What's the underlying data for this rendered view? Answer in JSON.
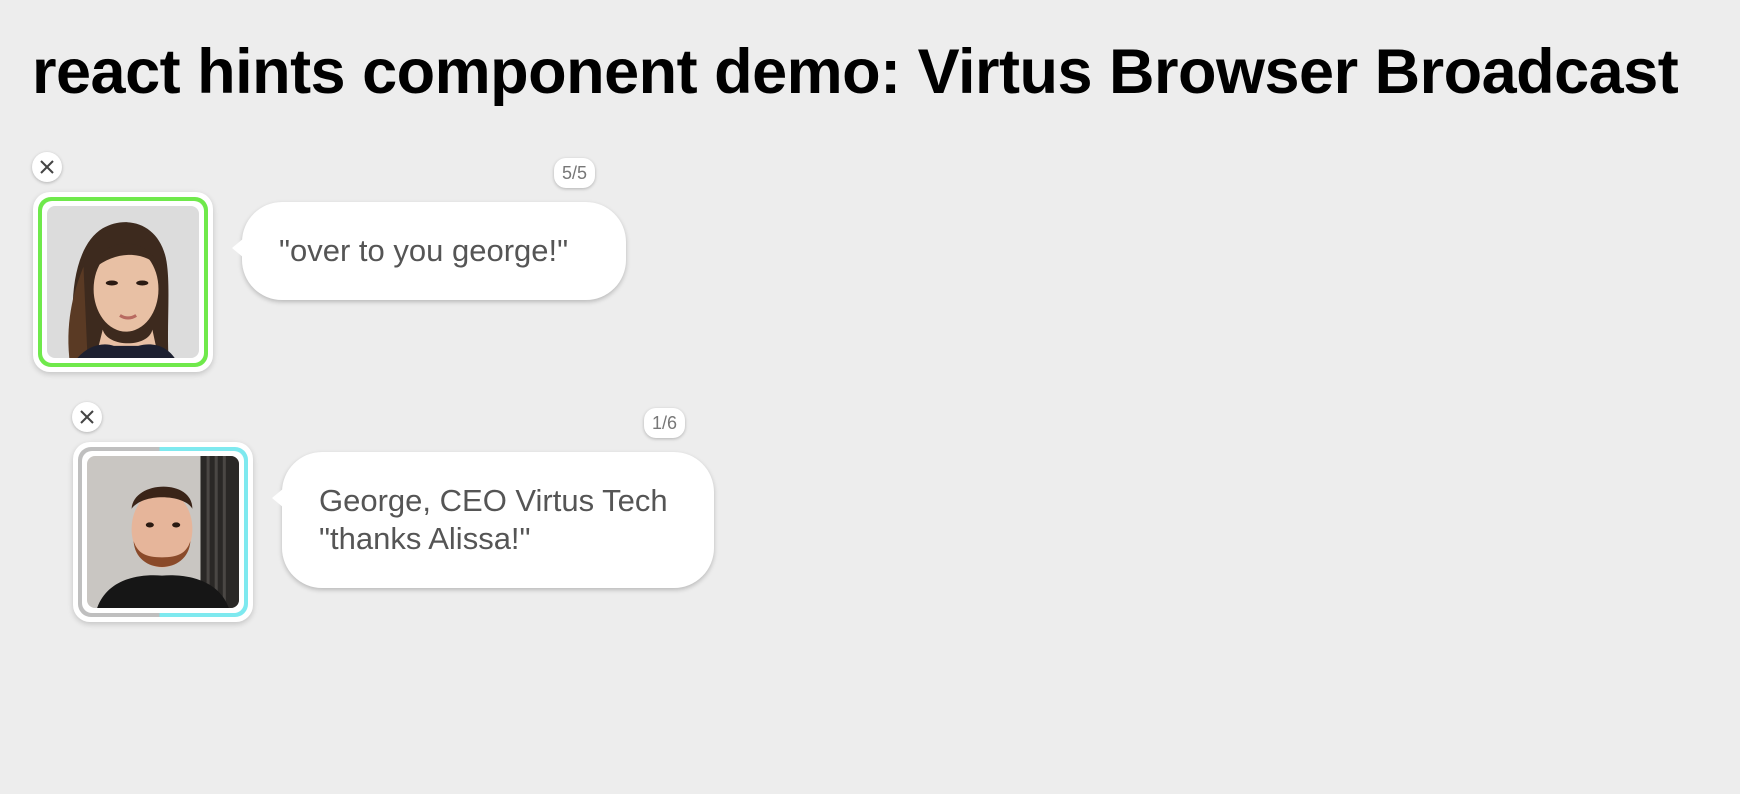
{
  "page": {
    "title": "react hints component demo: Virtus Browser Broadcast"
  },
  "hints": [
    {
      "counter": "5/5",
      "ring_color": "#6fe94b",
      "message_lines": [
        "\"over to you george!\""
      ],
      "avatar": "woman-portrait-photo"
    },
    {
      "counter": "1/6",
      "ring_colors": [
        "#bfbfbf",
        "#7ee9ef"
      ],
      "message_lines": [
        "George, CEO Virtus Tech",
        "\"thanks Alissa!\""
      ],
      "avatar": "man-portrait-photo"
    }
  ],
  "icons": {
    "close": "close-icon"
  },
  "colors": {
    "background": "#ededed",
    "bubble": "#ffffff",
    "text": "#555555"
  }
}
